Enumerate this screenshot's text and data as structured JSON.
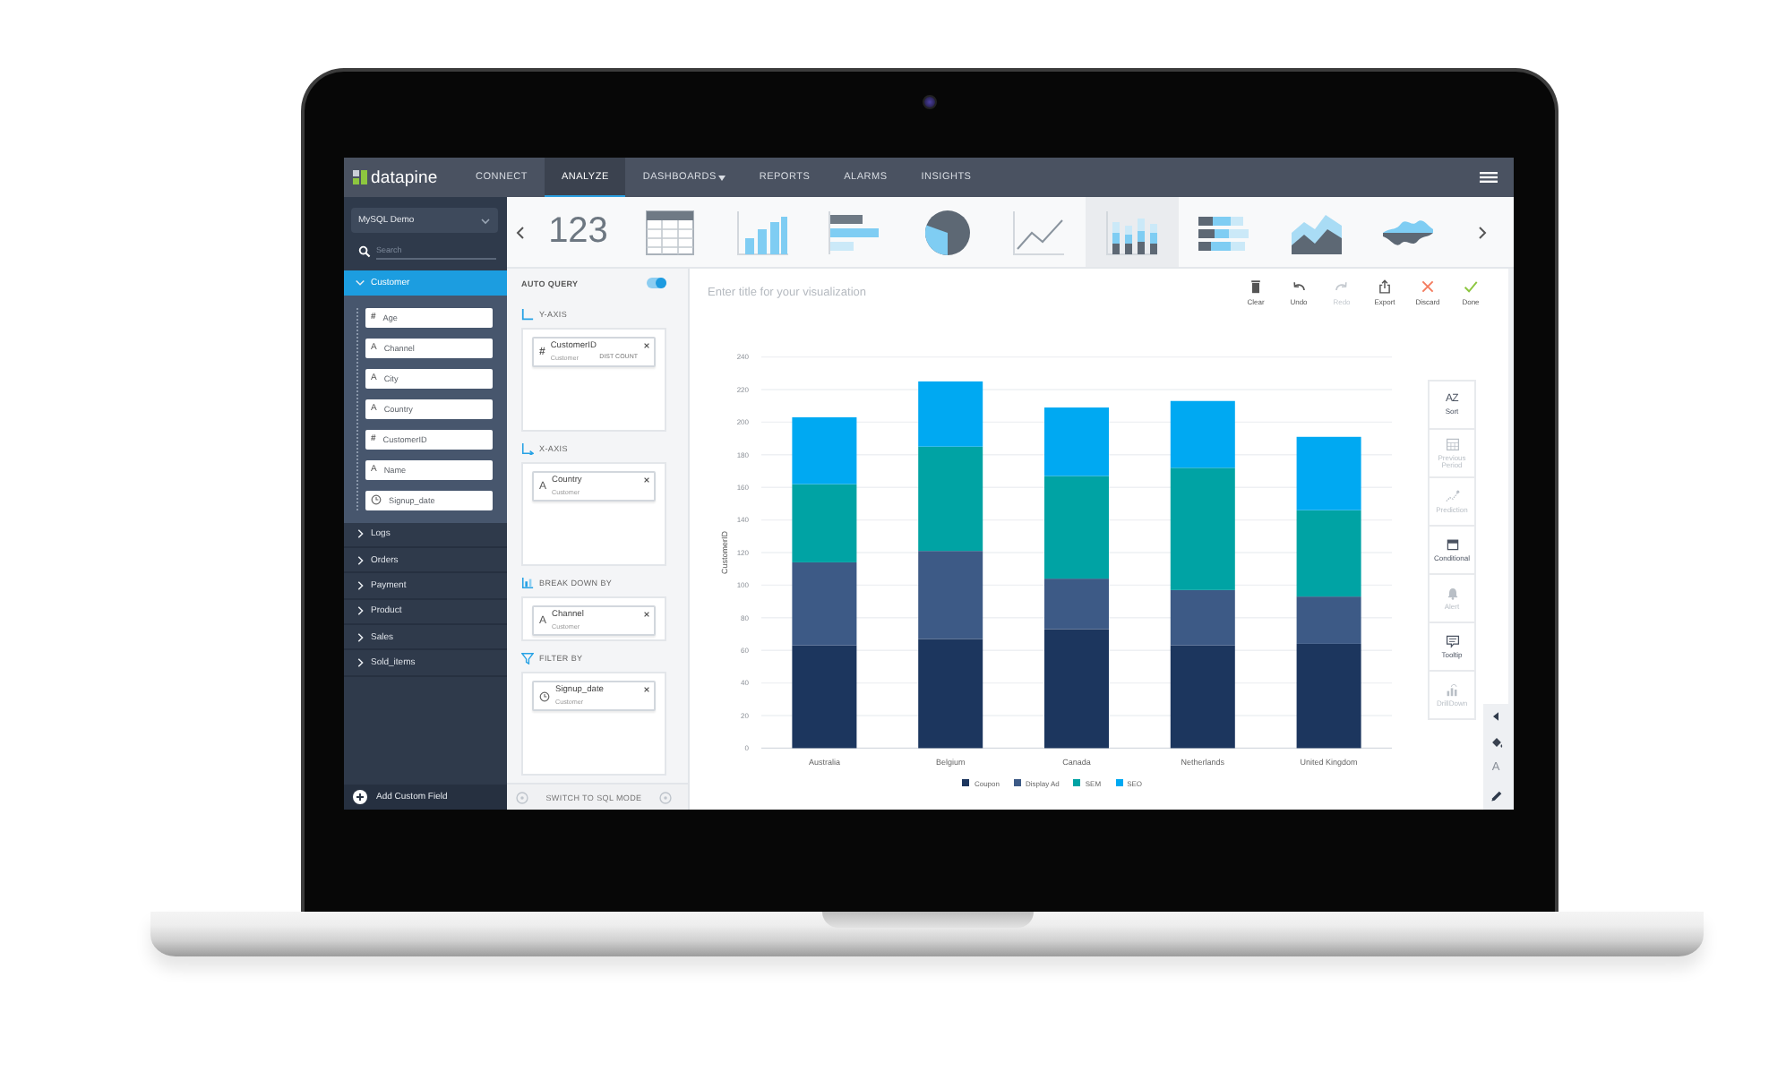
{
  "nav": {
    "logo": "datapine",
    "items": [
      {
        "label": "CONNECT",
        "selected": false,
        "dropdown": false
      },
      {
        "label": "ANALYZE",
        "selected": true,
        "dropdown": false
      },
      {
        "label": "DASHBOARDS",
        "selected": false,
        "dropdown": true
      },
      {
        "label": "REPORTS",
        "selected": false,
        "dropdown": false
      },
      {
        "label": "ALARMS",
        "selected": false,
        "dropdown": false
      },
      {
        "label": "INSIGHTS",
        "selected": false,
        "dropdown": false
      }
    ]
  },
  "sidebar": {
    "source": "MySQL Demo",
    "search": {
      "placeholder": "Search"
    },
    "tables": [
      {
        "name": "Customer",
        "selected": true,
        "expanded": true,
        "children": [
          {
            "name": "Age",
            "kind": "number",
            "symbol": "#"
          },
          {
            "name": "Channel",
            "kind": "text",
            "symbol": "A"
          },
          {
            "name": "City",
            "kind": "text",
            "symbol": "A"
          },
          {
            "name": "Country",
            "kind": "text",
            "symbol": "A"
          },
          {
            "name": "CustomerID",
            "kind": "number",
            "symbol": "#"
          },
          {
            "name": "Name",
            "kind": "text",
            "symbol": "A"
          },
          {
            "name": "Signup_date",
            "kind": "date"
          }
        ]
      },
      {
        "name": "Logs",
        "selected": false,
        "expanded": false
      },
      {
        "name": "Orders",
        "selected": false,
        "expanded": false
      },
      {
        "name": "Payment",
        "selected": false,
        "expanded": false
      },
      {
        "name": "Product",
        "selected": false,
        "expanded": false
      },
      {
        "name": "Sales",
        "selected": false,
        "expanded": false
      },
      {
        "name": "Sold_items",
        "selected": false,
        "expanded": false
      }
    ],
    "add_field": "Add Custom Field"
  },
  "chart_types": [
    {
      "kind": "number",
      "label": "123",
      "selected": false
    },
    {
      "kind": "table",
      "selected": false
    },
    {
      "kind": "column",
      "selected": false
    },
    {
      "kind": "bar",
      "selected": false
    },
    {
      "kind": "pie",
      "selected": false
    },
    {
      "kind": "line",
      "selected": false
    },
    {
      "kind": "stacked_column",
      "selected": true
    },
    {
      "kind": "stacked_bar",
      "selected": false
    },
    {
      "kind": "area",
      "selected": false
    },
    {
      "kind": "stream",
      "selected": false
    }
  ],
  "query": {
    "auto_query": {
      "label": "AUTO QUERY",
      "on": true
    },
    "sections": [
      {
        "kind": "y_axis",
        "label": "Y-AXIS",
        "fields": [
          {
            "name": "CustomerID",
            "table": "Customer",
            "kind": "number",
            "symbol": "#",
            "aggregation": "DIST COUNT"
          }
        ]
      },
      {
        "kind": "x_axis",
        "label": "X-AXIS",
        "fields": [
          {
            "name": "Country",
            "table": "Customer",
            "kind": "text",
            "symbol": "A"
          }
        ]
      },
      {
        "kind": "breakdown",
        "label": "BREAK DOWN BY",
        "fields": [
          {
            "name": "Channel",
            "table": "Customer",
            "kind": "text",
            "symbol": "A"
          }
        ]
      },
      {
        "kind": "filter",
        "label": "FILTER BY",
        "fields": [
          {
            "name": "Signup_date",
            "table": "Customer",
            "kind": "date"
          }
        ]
      }
    ],
    "sql_mode": "SWITCH TO SQL MODE"
  },
  "visualization": {
    "title": {
      "placeholder": "Enter title for your visualization"
    },
    "actions": [
      {
        "kind": "clear",
        "label": "Clear",
        "disabled": false
      },
      {
        "kind": "undo",
        "label": "Undo",
        "disabled": false
      },
      {
        "kind": "redo",
        "label": "Redo",
        "disabled": true
      },
      {
        "kind": "export",
        "label": "Export",
        "disabled": false
      },
      {
        "kind": "discard",
        "label": "Discard",
        "disabled": false
      },
      {
        "kind": "done",
        "label": "Done",
        "disabled": false
      }
    ],
    "chart_data": {
      "type": "bar",
      "orientation": "vertical",
      "stacked": true,
      "grid": true,
      "legend": true,
      "ylabel": "CustomerID",
      "categories": [
        "Australia",
        "Belgium",
        "Canada",
        "Netherlands",
        "United Kingdom"
      ],
      "series": [
        {
          "name": "Coupon",
          "color": "#1c365e",
          "values": [
            63,
            67,
            73,
            63,
            64
          ]
        },
        {
          "name": "Display Ad",
          "color": "#3d5a86",
          "values": [
            51,
            54,
            31,
            34,
            29
          ]
        },
        {
          "name": "SEM",
          "color": "#00a3a4",
          "values": [
            48,
            64,
            63,
            75,
            53
          ]
        },
        {
          "name": "SEO",
          "color": "#00a9f2",
          "values": [
            41,
            40,
            42,
            41,
            45
          ]
        }
      ],
      "ylim": [
        0,
        240
      ],
      "yticks": [
        0,
        20,
        40,
        60,
        80,
        100,
        120,
        140,
        160,
        180,
        200,
        220,
        240
      ]
    },
    "tools": [
      {
        "kind": "sort",
        "label": "Sort",
        "symbol": "AZ",
        "disabled": false
      },
      {
        "kind": "previous_period",
        "label": "Previous Period",
        "disabled": true
      },
      {
        "kind": "prediction",
        "label": "Prediction",
        "disabled": true
      },
      {
        "kind": "conditional",
        "label": "Conditional",
        "disabled": false
      },
      {
        "kind": "alert",
        "label": "Alert",
        "disabled": true
      },
      {
        "kind": "tooltip",
        "label": "Tooltip",
        "disabled": false
      },
      {
        "kind": "drilldown",
        "label": "DrillDown",
        "disabled": true
      }
    ],
    "format_toolbar": {
      "text_tool": "A"
    }
  }
}
